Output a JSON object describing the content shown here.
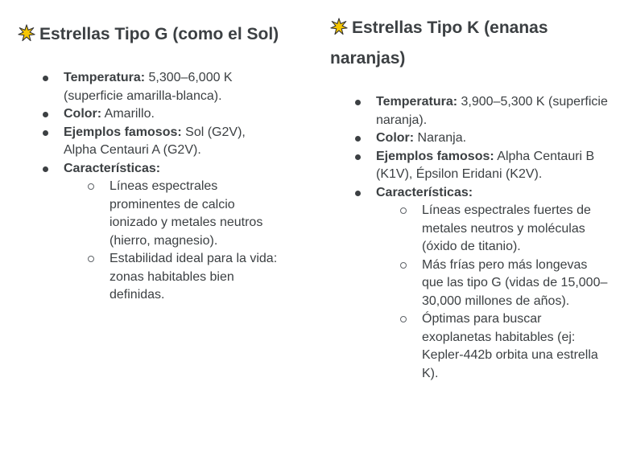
{
  "g": {
    "title_bold": "Estrellas Tipo G",
    "title_rest": " (como el Sol)",
    "temp_label": "Temperatura:",
    "temp_value": " 5,300–6,000 K (superficie amarilla-blanca).",
    "color_label": "Color:",
    "color_value": " Amarillo.",
    "examples_label": "Ejemplos famosos:",
    "examples_value": " Sol (G2V), Alpha Centauri A (G2V).",
    "features_label": "Características:",
    "features": [
      "Líneas espectrales prominentes de calcio ionizado y metales neutros (hierro, magnesio).",
      "Estabilidad ideal para la vida: zonas habitables bien definidas."
    ]
  },
  "k": {
    "title_bold": "Estrellas Tipo K",
    "title_rest": " (enanas naranjas)",
    "temp_label": "Temperatura:",
    "temp_value": " 3,900–5,300 K (superficie naranja).",
    "color_label": "Color:",
    "color_value": " Naranja.",
    "examples_label": "Ejemplos famosos:",
    "examples_value": " Alpha Centauri B (K1V), Épsilon Eridani (K2V).",
    "features_label": "Características:",
    "features": [
      "Líneas espectrales fuertes de metales neutros y moléculas (óxido de titanio).",
      "Más frías pero más longevas que las tipo G (vidas de 15,000–30,000 millones de años).",
      "Óptimas para buscar exoplanetas habitables (ej: Kepler-442b orbita una estrella K)."
    ]
  },
  "icons": {
    "heading_icon": "sparkle-star-icon",
    "star_fill": "#f7c600",
    "star_stroke": "#333333"
  }
}
